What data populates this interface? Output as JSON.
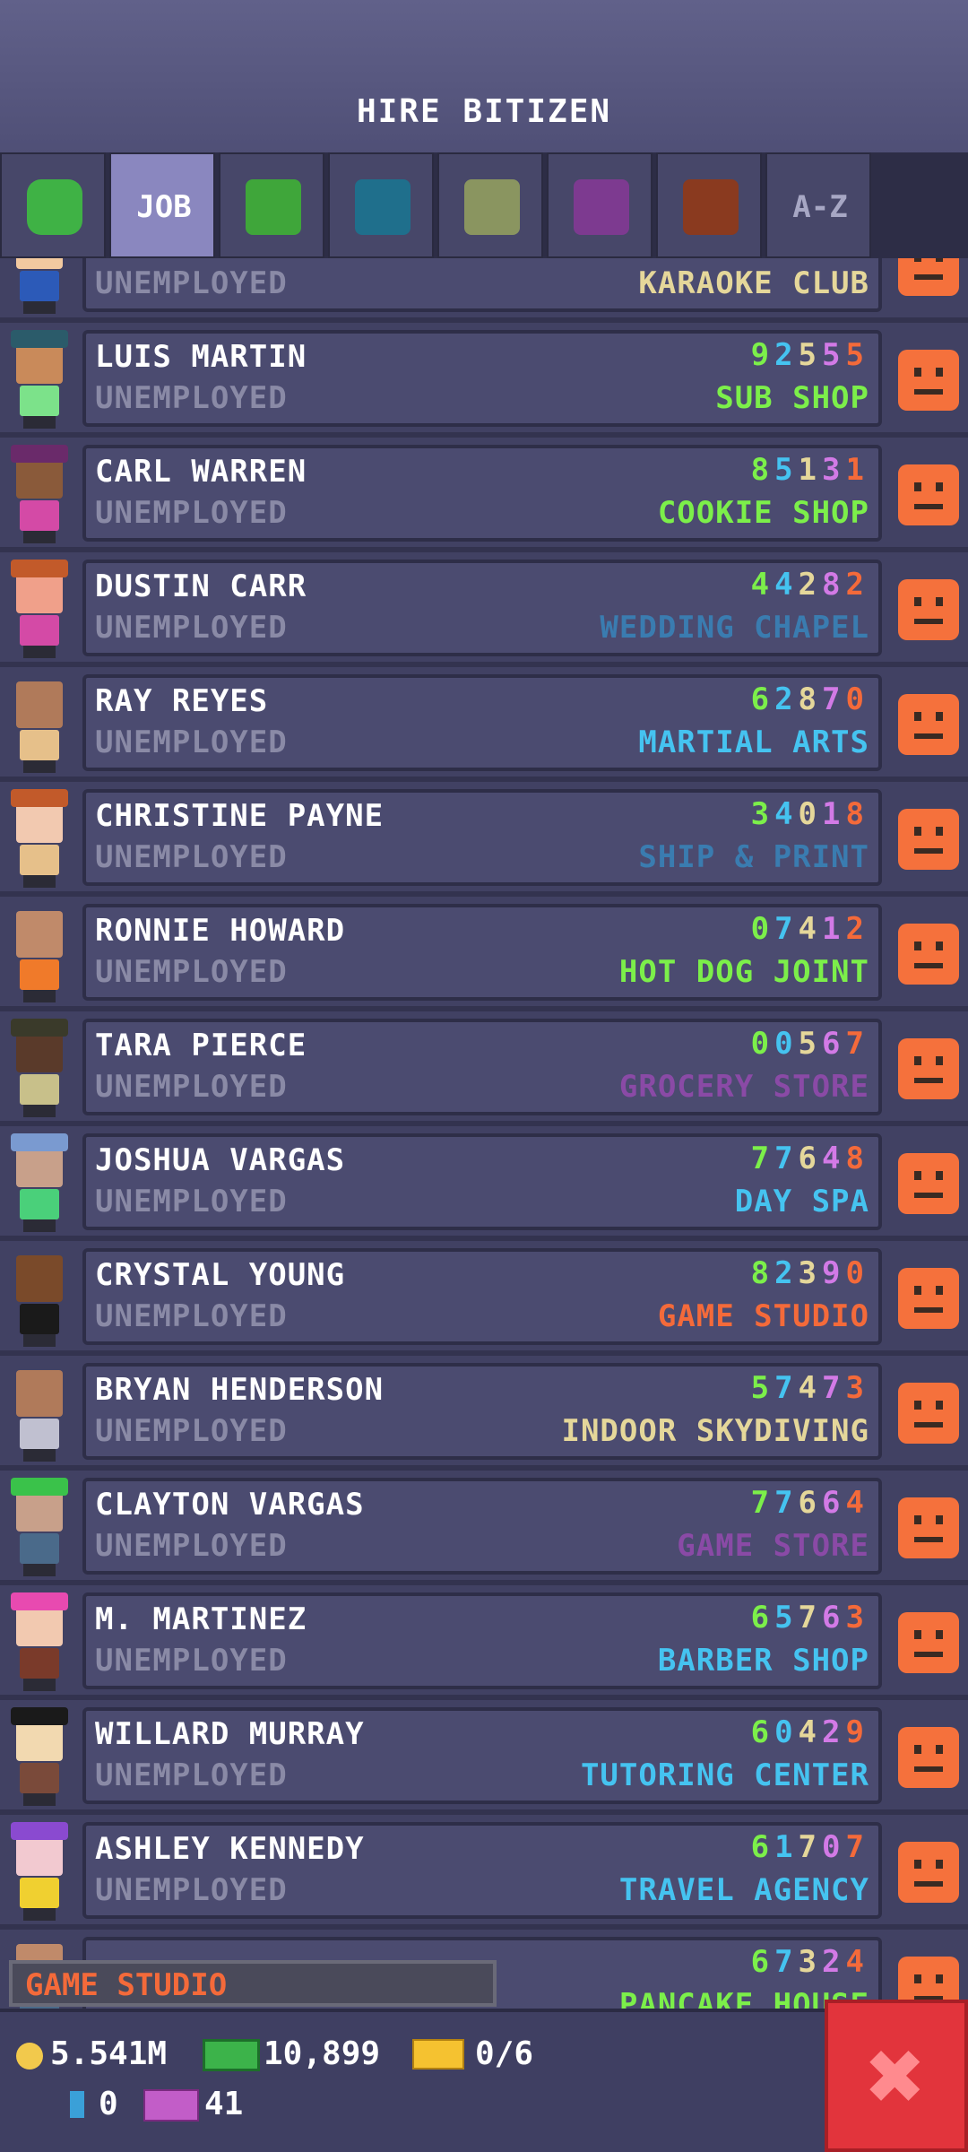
{
  "header": {
    "title": "HIRE BITIZEN"
  },
  "tabs": [
    {
      "type": "icon",
      "name": "tab-happy",
      "color": "#3fb245"
    },
    {
      "type": "label",
      "label": "JOB",
      "active": true
    },
    {
      "type": "swatch",
      "color": "#3fa63a"
    },
    {
      "type": "swatch",
      "color": "#1f6f8c"
    },
    {
      "type": "swatch",
      "color": "#8a9560"
    },
    {
      "type": "swatch",
      "color": "#7d3a90"
    },
    {
      "type": "swatch",
      "color": "#8a3a1f"
    },
    {
      "type": "label",
      "label": "A-Z"
    }
  ],
  "rows": [
    {
      "name": "",
      "status": "UNEMPLOYED",
      "code": "",
      "business": "KARAOKE CLUB",
      "bizColor": "#e5d79a",
      "skin": "#f2c9a0",
      "shirt": "#2c5ab8",
      "hat": ""
    },
    {
      "name": "LUIS MARTIN",
      "status": "UNEMPLOYED",
      "code": "92555",
      "business": "SUB SHOP",
      "bizColor": "#7cef4a",
      "skin": "#c98a5a",
      "shirt": "#7ce28a",
      "hat": "#2b5b6a"
    },
    {
      "name": "CARL WARREN",
      "status": "UNEMPLOYED",
      "code": "85131",
      "business": "COOKIE SHOP",
      "bizColor": "#7cef4a",
      "skin": "#8a5a3a",
      "shirt": "#d44aa6",
      "hat": "#6a2a6a"
    },
    {
      "name": "DUSTIN CARR",
      "status": "UNEMPLOYED",
      "code": "44282",
      "business": "WEDDING CHAPEL",
      "bizColor": "#3a7cb0",
      "skin": "#f0a08a",
      "shirt": "#d44aa6",
      "hat": "#c25a2a"
    },
    {
      "name": "RAY REYES",
      "status": "UNEMPLOYED",
      "code": "62870",
      "business": "MARTIAL ARTS",
      "bizColor": "#45c3f0",
      "skin": "#b07a5a",
      "shirt": "#e6c08a",
      "hat": ""
    },
    {
      "name": "CHRISTINE PAYNE",
      "status": "UNEMPLOYED",
      "code": "34018",
      "business": "SHIP & PRINT",
      "bizColor": "#3a7cb0",
      "skin": "#f2c9b0",
      "shirt": "#e6c08a",
      "hat": "#c25a2a"
    },
    {
      "name": "RONNIE HOWARD",
      "status": "UNEMPLOYED",
      "code": "07412",
      "business": "HOT DOG JOINT",
      "bizColor": "#7cef4a",
      "skin": "#c08a6a",
      "shirt": "#f07a2a",
      "hat": ""
    },
    {
      "name": "TARA PIERCE",
      "status": "UNEMPLOYED",
      "code": "00567",
      "business": "GROCERY STORE",
      "bizColor": "#8a4aa6",
      "skin": "#5a3a2a",
      "shirt": "#c8c08a",
      "hat": "#3a3a2a"
    },
    {
      "name": "JOSHUA VARGAS",
      "status": "UNEMPLOYED",
      "code": "77648",
      "business": "DAY SPA",
      "bizColor": "#45c3f0",
      "skin": "#c8a08a",
      "shirt": "#4ad07a",
      "hat": "#7a9ad0"
    },
    {
      "name": "CRYSTAL YOUNG",
      "status": "UNEMPLOYED",
      "code": "82390",
      "business": "GAME STUDIO",
      "bizColor": "#f46a3a",
      "skin": "#7a4a2a",
      "shirt": "#1a1a1a",
      "hat": ""
    },
    {
      "name": "BRYAN HENDERSON",
      "status": "UNEMPLOYED",
      "code": "57473",
      "business": "INDOOR SKYDIVING",
      "bizColor": "#e5d79a",
      "skin": "#b07a5a",
      "shirt": "#c0c0d0",
      "hat": ""
    },
    {
      "name": "CLAYTON VARGAS",
      "status": "UNEMPLOYED",
      "code": "77664",
      "business": "GAME STORE",
      "bizColor": "#8a4aa6",
      "skin": "#c8a08a",
      "shirt": "#4a6a8a",
      "hat": "#3ac24a"
    },
    {
      "name": "M. MARTINEZ",
      "status": "UNEMPLOYED",
      "code": "65763",
      "business": "BARBER SHOP",
      "bizColor": "#45c3f0",
      "skin": "#f2c9b0",
      "shirt": "#7a3a2a",
      "hat": "#e84ab0"
    },
    {
      "name": "WILLARD MURRAY",
      "status": "UNEMPLOYED",
      "code": "60429",
      "business": "TUTORING CENTER",
      "bizColor": "#45c3f0",
      "skin": "#f2d9b0",
      "shirt": "#7a4a3a",
      "hat": "#1a1a1a"
    },
    {
      "name": "ASHLEY KENNEDY",
      "status": "UNEMPLOYED",
      "code": "61707",
      "business": "TRAVEL AGENCY",
      "bizColor": "#45c3f0",
      "skin": "#f2c9d0",
      "shirt": "#f0d030",
      "hat": "#8a4ad0"
    },
    {
      "name": "",
      "status": "",
      "code": "67324",
      "business": "PANCAKE HOUSE",
      "bizColor": "#7cef4a",
      "skin": "#c08a6a",
      "shirt": "#4a6a8a",
      "hat": ""
    }
  ],
  "digitColors": [
    "#7cef4a",
    "#45c3f0",
    "#e5d79a",
    "#d27ae6",
    "#f46a3a"
  ],
  "floatingLabel": "GAME STUDIO",
  "currency": {
    "coins": "5.541M",
    "bux": "10,899",
    "tickets": "0/6",
    "bars": "0",
    "vip": "41"
  },
  "close": {
    "label": "✖"
  }
}
